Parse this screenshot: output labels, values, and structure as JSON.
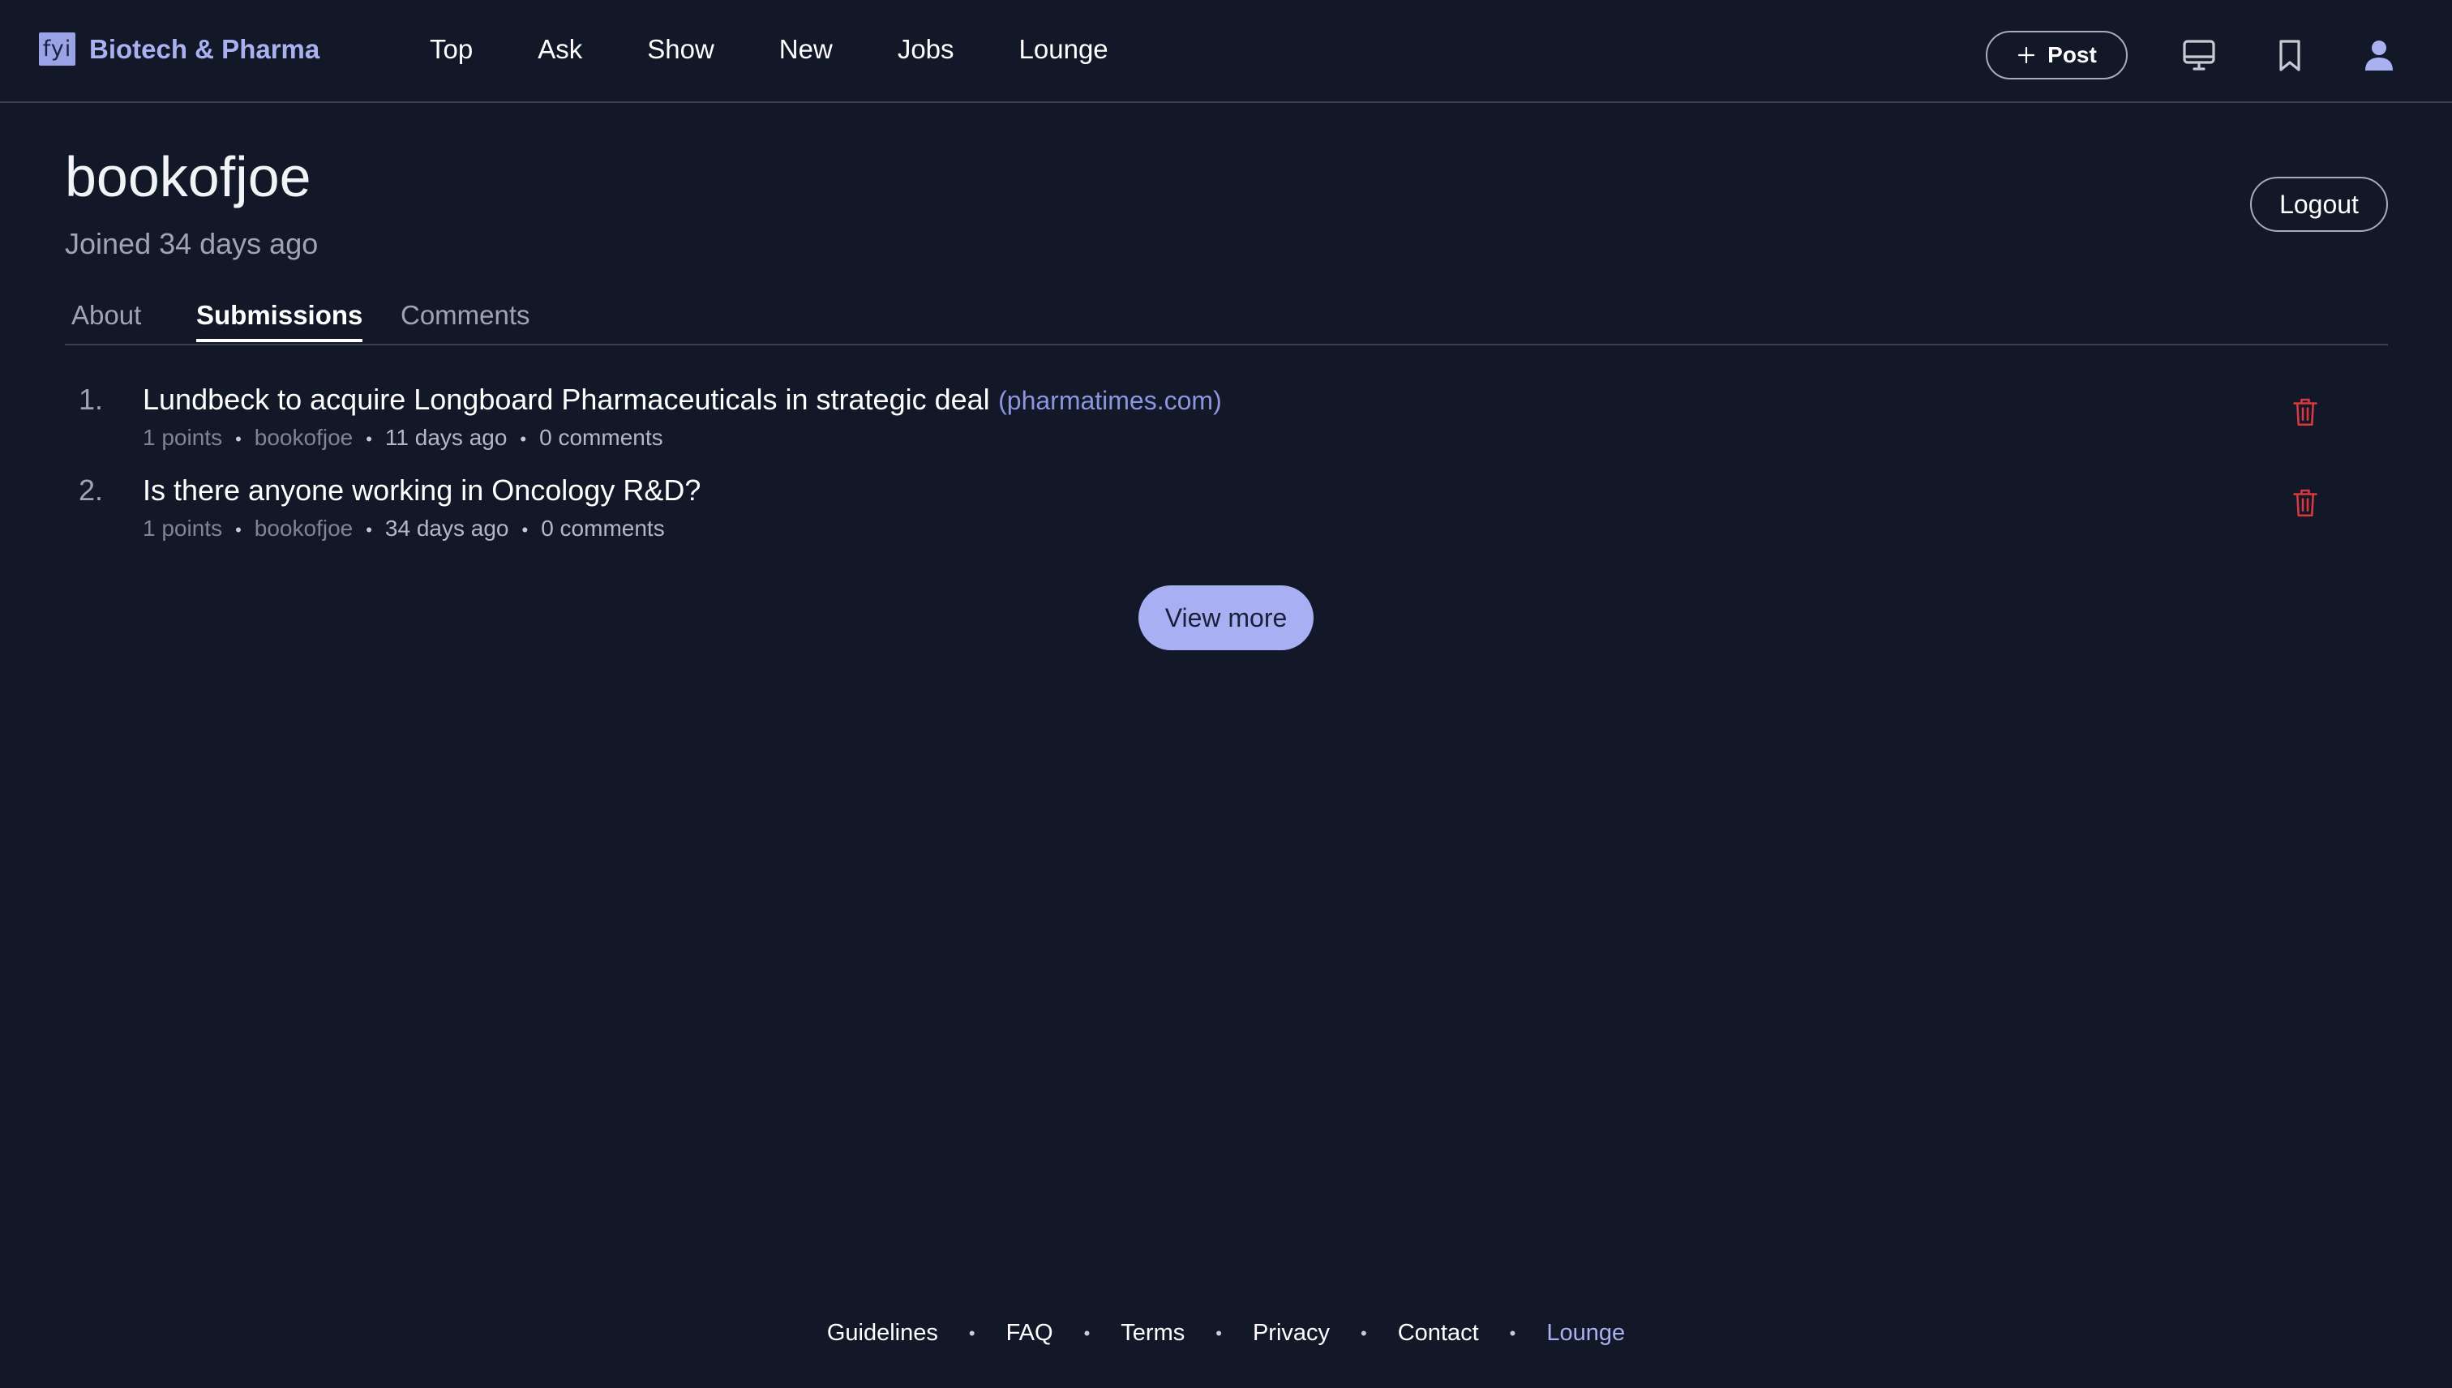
{
  "brand": {
    "logo_text": "fyi",
    "name": "Biotech & Pharma"
  },
  "nav": [
    {
      "label": "Top"
    },
    {
      "label": "Ask"
    },
    {
      "label": "Show"
    },
    {
      "label": "New"
    },
    {
      "label": "Jobs"
    },
    {
      "label": "Lounge"
    }
  ],
  "header": {
    "post_label": "Post",
    "icons": [
      "monitor-icon",
      "bookmark-icon",
      "user-icon"
    ]
  },
  "profile": {
    "username": "bookofjoe",
    "joined": "Joined 34 days ago",
    "logout_label": "Logout"
  },
  "tabs": [
    {
      "label": "About",
      "active": false
    },
    {
      "label": "Submissions",
      "active": true
    },
    {
      "label": "Comments",
      "active": false
    }
  ],
  "submissions": [
    {
      "rank": "1.",
      "title": "Lundbeck to acquire Longboard Pharmaceuticals in strategic deal",
      "domain": "(pharmatimes.com)",
      "points": "1 points",
      "author": "bookofjoe",
      "time": "11 days ago",
      "comments": "0 comments"
    },
    {
      "rank": "2.",
      "title": "Is there anyone working in Oncology R&D?",
      "domain": "",
      "points": "1 points",
      "author": "bookofjoe",
      "time": "34 days ago",
      "comments": "0 comments"
    }
  ],
  "view_more_label": "View more",
  "footer": [
    {
      "label": "Guidelines"
    },
    {
      "label": "FAQ"
    },
    {
      "label": "Terms"
    },
    {
      "label": "Privacy"
    },
    {
      "label": "Contact"
    },
    {
      "label": "Lounge"
    }
  ],
  "colors": {
    "background": "#121828",
    "accent": "#a9b1f0",
    "danger": "#d9393d",
    "muted": "#9ea4b2"
  }
}
